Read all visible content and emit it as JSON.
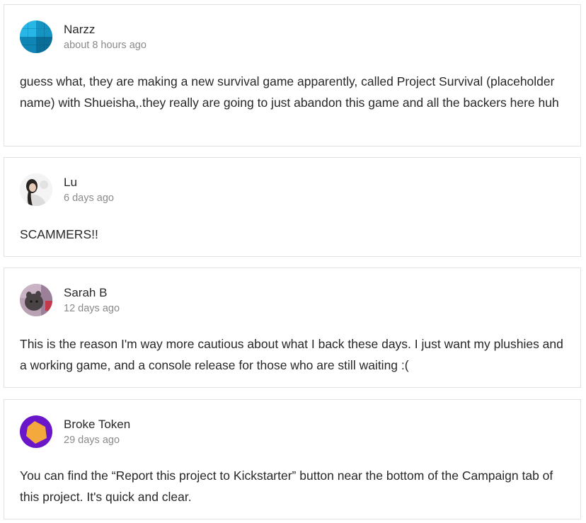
{
  "comments": [
    {
      "author": "Narzz",
      "time": "about 8 hours ago",
      "avatar_icon": "blue-geometric-avatar",
      "body": "guess what, they are making a new survival game apparently, called Project Survival (placeholder name) with Shueisha,.they really are going to just abandon this game and all the backers here huh"
    },
    {
      "author": "Lu",
      "time": "6 days ago",
      "avatar_icon": "photo-avatar",
      "body": "SCAMMERS!!"
    },
    {
      "author": "Sarah B",
      "time": "12 days ago",
      "avatar_icon": "plush-photo-avatar",
      "body": "This is the reason I'm way more cautious about what I back these days. I just want my plushies and a working game, and a console release for those who are still waiting :("
    },
    {
      "author": "Broke Token",
      "time": "29 days ago",
      "avatar_icon": "purple-orange-pentagon-avatar",
      "body": "You can find the “Report this project to Kickstarter” button near the bottom of the Campaign tab of this project. It's quick and clear."
    }
  ],
  "colors": {
    "text": "#282828",
    "muted": "#8a8a8a",
    "border": "#e3e3e3"
  }
}
